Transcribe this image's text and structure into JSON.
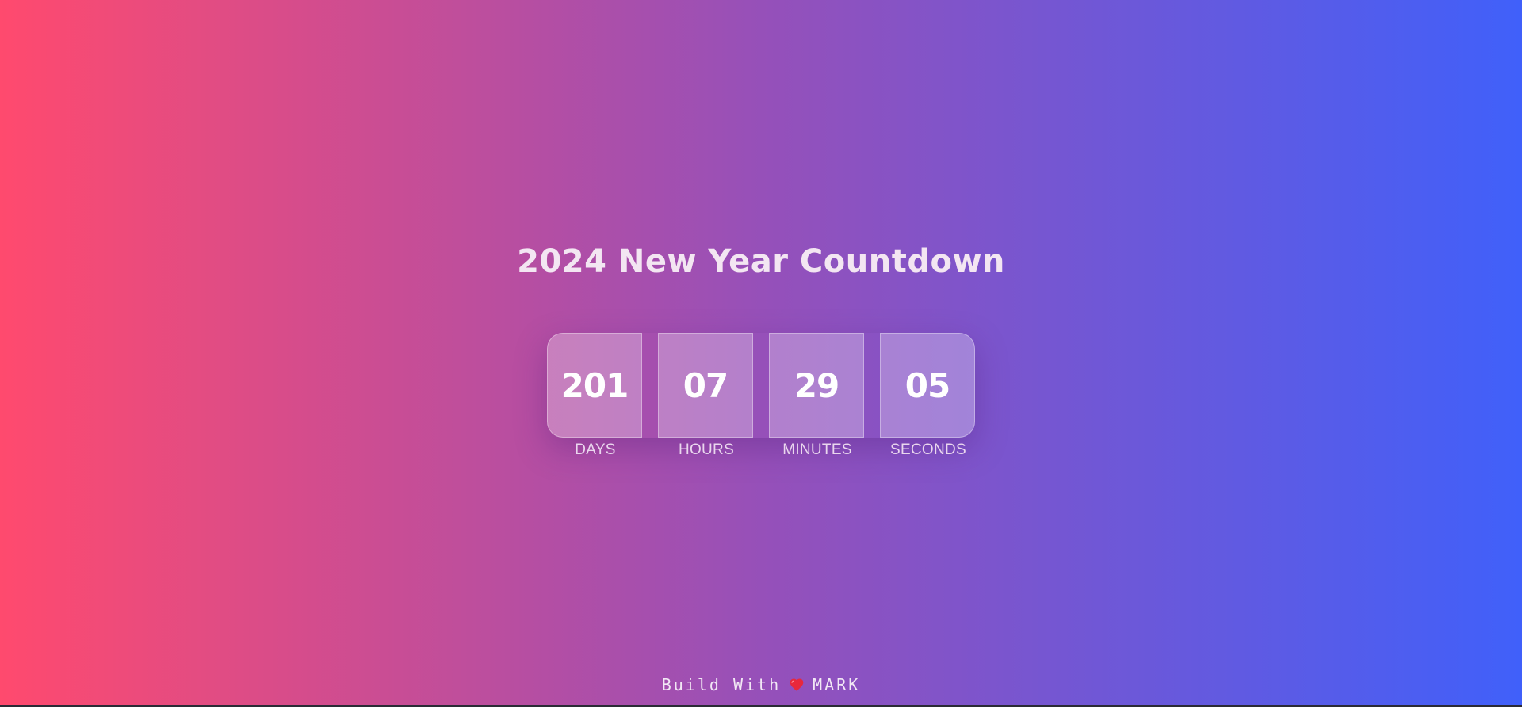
{
  "page": {
    "title": "2024 New Year Countdown"
  },
  "countdown": {
    "units": [
      {
        "value": "201",
        "label": "DAYS"
      },
      {
        "value": "07",
        "label": "HOURS"
      },
      {
        "value": "29",
        "label": "MINUTES"
      },
      {
        "value": "05",
        "label": "SECONDS"
      }
    ]
  },
  "footer": {
    "prefix": "Build With",
    "icon": "heart-icon",
    "author": "MARK"
  },
  "colors": {
    "gradient_start": "#ff4a6e",
    "gradient_mid": "#9650b9",
    "gradient_end": "#4060fa",
    "heart": "#e8283c"
  }
}
